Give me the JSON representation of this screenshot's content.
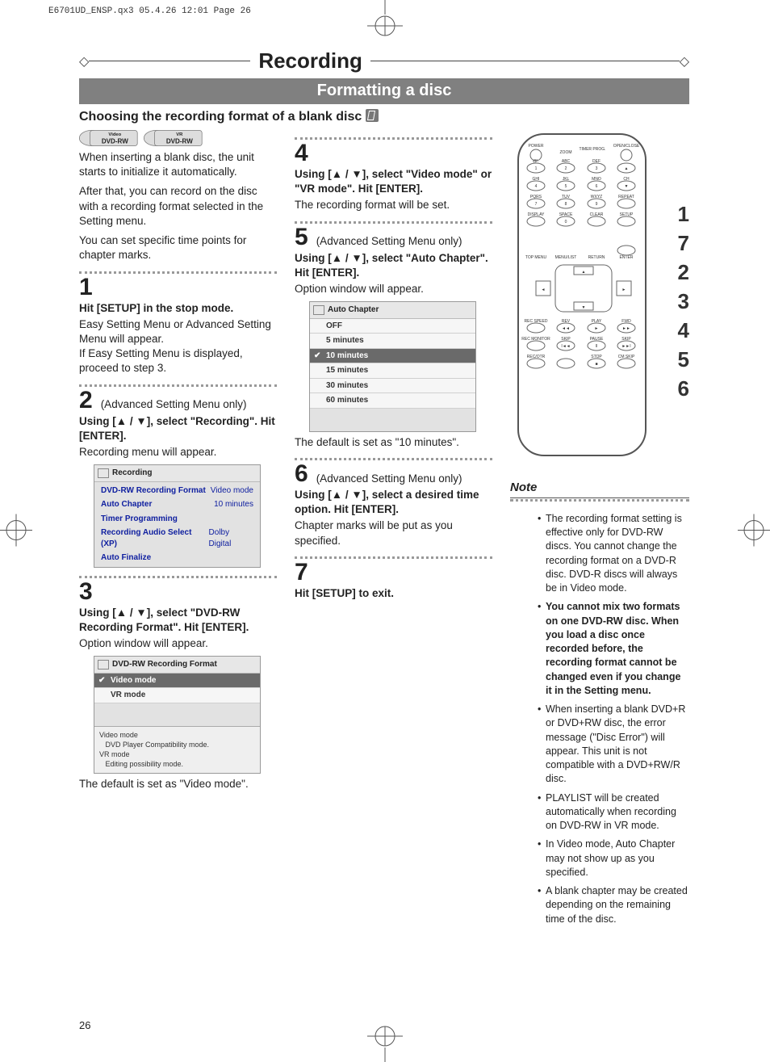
{
  "printhead": "E6701UD_ENSP.qx3  05.4.26 12:01  Page 26",
  "title": "Recording",
  "subtitle": "Formatting a disc",
  "choose_line": "Choosing the recording format of a blank disc",
  "badges": [
    "Video DVD-RW",
    "VR DVD-RW"
  ],
  "intro": [
    "When inserting a blank disc, the unit starts to initialize it automatically.",
    "After that, you can record on the disc with a recording format selected in the Setting menu.",
    "You can set specific time points for chapter marks."
  ],
  "steps": {
    "s1": {
      "num": "1",
      "head": "Hit [SETUP] in the stop mode.",
      "body": "Easy Setting Menu or Advanced Setting Menu will appear.\nIf Easy Setting Menu is displayed, proceed to step 3."
    },
    "s2": {
      "num": "2",
      "advnote": "(Advanced Setting Menu only)",
      "head": "Using [▲ / ▼], select \"Recording\". Hit [ENTER].",
      "body": "Recording menu will appear."
    },
    "s3": {
      "num": "3",
      "head": "Using [▲ / ▼], select \"DVD-RW Recording Format\". Hit [ENTER].",
      "body": "Option window will appear.",
      "tail": "The default is set as \"Video mode\"."
    },
    "s4": {
      "num": "4",
      "head": "Using [▲ / ▼], select \"Video mode\" or \"VR mode\". Hit [ENTER].",
      "body": "The recording format will be set."
    },
    "s5": {
      "num": "5",
      "advnote": "(Advanced Setting Menu only)",
      "head": "Using [▲ / ▼], select \"Auto Chapter\". Hit [ENTER].",
      "body": "Option window will appear.",
      "tail": "The default is set as \"10 minutes\"."
    },
    "s6": {
      "num": "6",
      "advnote": "(Advanced Setting Menu only)",
      "head": "Using [▲ / ▼], select a desired time option. Hit [ENTER].",
      "body": "Chapter marks will be put as you specified."
    },
    "s7": {
      "num": "7",
      "head": "Hit [SETUP] to exit."
    }
  },
  "osd_recording": {
    "title": "Recording",
    "rows": [
      [
        "DVD-RW Recording Format",
        "Video mode"
      ],
      [
        "Auto Chapter",
        "10 minutes"
      ],
      [
        "Timer Programming",
        ""
      ],
      [
        "Recording Audio Select (XP)",
        "Dolby Digital"
      ],
      [
        "Auto Finalize",
        ""
      ]
    ]
  },
  "osd_format": {
    "title": "DVD-RW Recording Format",
    "items": [
      {
        "label": "Video mode",
        "sel": true,
        "tick": true
      },
      {
        "label": "VR mode"
      }
    ],
    "footer": "Video mode\n   DVD Player Compatibility mode.\nVR mode\n   Editing possibility mode."
  },
  "osd_autochapter": {
    "title": "Auto Chapter",
    "items": [
      {
        "label": "OFF"
      },
      {
        "label": "5 minutes"
      },
      {
        "label": "10 minutes",
        "sel": true,
        "tick": true
      },
      {
        "label": "15 minutes"
      },
      {
        "label": "30 minutes"
      },
      {
        "label": "60 minutes"
      }
    ]
  },
  "remote": {
    "labels": {
      "power": "POWER",
      "openclose": "OPEN/CLOSE",
      "zoom": "ZOOM",
      "timerprog": "TIMER PROG.",
      "at": "@!.",
      "abc": "ABC",
      "def": "DEF",
      "r1": [
        "1",
        "2",
        "3"
      ],
      "ghi": "GHI",
      "jkl": "JKL",
      "mno": "MNO",
      "ch": "CH",
      "r2": [
        "4",
        "5",
        "6"
      ],
      "pqrs": "PQRS",
      "tuv": "TUV",
      "wxyz": "WXYZ",
      "repeat": "REPEAT",
      "r3": [
        "7",
        "8",
        "9"
      ],
      "display": "DISPLAY",
      "space": "SPACE",
      "clear": "CLEAR",
      "setup": "SETUP",
      "r4": [
        "0"
      ],
      "topmenu": "TOP MENU",
      "menulist": "MENU/LIST",
      "return": "RETURN",
      "enter": "ENTER",
      "recspeed": "REC SPEED",
      "rev": "REV",
      "play": "PLAY",
      "fwd": "FWD",
      "recmonitor": "REC MONITOR",
      "skip1": "SKIP",
      "pause": "PAUSE",
      "skip2": "SKIP",
      "recotr": "REC/OTR",
      "stop": "STOP",
      "cmskip": "CM SKIP"
    },
    "side_numbers": [
      "1",
      "7",
      "2",
      "3",
      "4",
      "5",
      "6"
    ]
  },
  "note_title": "Note",
  "notes": [
    {
      "t": "The recording format setting is effective only for DVD-RW discs. You cannot change the recording format on a DVD-R disc. DVD-R discs will always be in Video mode."
    },
    {
      "t": "You cannot mix two formats on one DVD-RW disc. When you load a disc once recorded before, the recording format cannot be changed even if you change it in the Setting menu.",
      "bold": true
    },
    {
      "t": "When inserting a blank DVD+R or DVD+RW disc, the error message (\"Disc Error\") will appear. This unit is not compatible with a DVD+RW/R disc."
    },
    {
      "t": "PLAYLIST will be created automatically when recording on DVD-RW in VR mode."
    },
    {
      "t": "In Video mode, Auto Chapter may not show up as you specified."
    },
    {
      "t": "A blank chapter may be created depending on the remaining time of the disc."
    }
  ],
  "page_number": "26"
}
